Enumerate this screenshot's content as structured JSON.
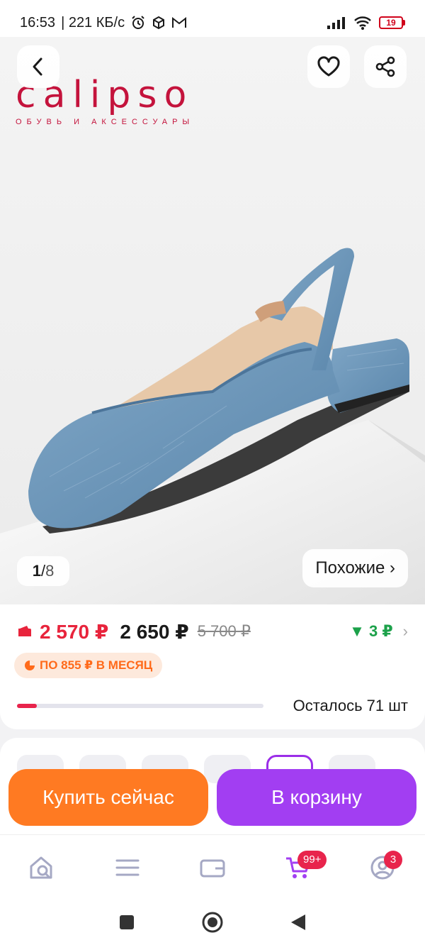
{
  "status_bar": {
    "time": "16:53",
    "speed": "| 221 КБ/с",
    "battery": "19"
  },
  "hero": {
    "brand_name": "calipso",
    "brand_tagline": "ОБУВЬ И АКСЕССУАРЫ",
    "pager_current": "1",
    "pager_separator": "/",
    "pager_total": "8",
    "similar_label": "Похожие ›"
  },
  "price": {
    "card_price": "2 570 ₽",
    "price": "2 650 ₽",
    "old_price": "5 700 ₽",
    "cashback": "▼ 3 ₽",
    "installment": "ПО 855 ₽ В МЕСЯЦ"
  },
  "stock": {
    "text": "Осталось 71 шт",
    "fill_fraction": 0.08
  },
  "actions": {
    "buy_now": "Купить сейчас",
    "add_to_cart": "В корзину"
  },
  "bottom_nav": {
    "cart_badge": "99+",
    "profile_badge": "3"
  },
  "colors": {
    "buy_button": "#ff7a22",
    "cart_button": "#a23ef2",
    "card_price": "#e8243c",
    "cashback": "#1ca14a",
    "brand": "#c4133c"
  }
}
